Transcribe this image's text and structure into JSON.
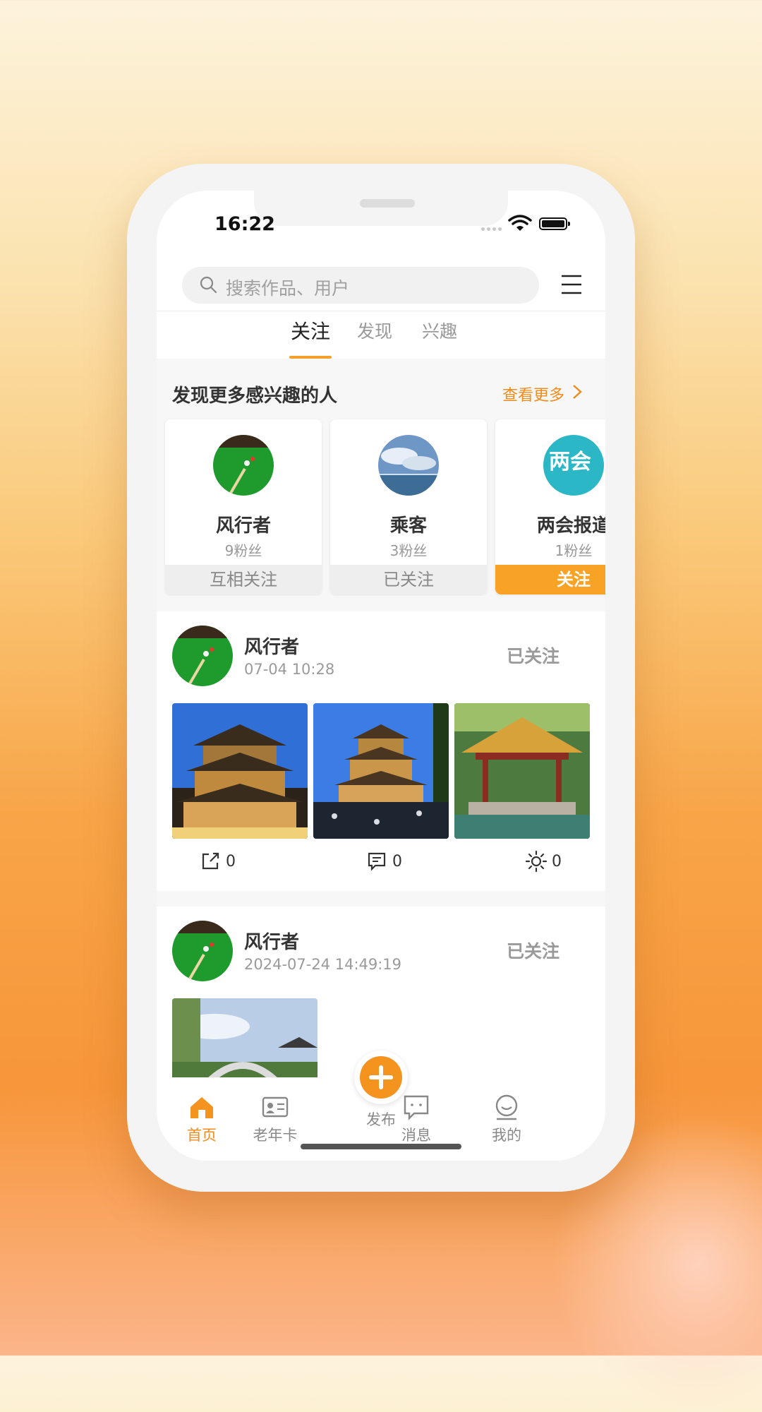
{
  "status_bar": {
    "time": "16:22"
  },
  "search": {
    "placeholder": "搜索作品、用户"
  },
  "tabs": [
    {
      "label": "关注",
      "active": true
    },
    {
      "label": "发现",
      "active": false
    },
    {
      "label": "兴趣",
      "active": false
    }
  ],
  "recommend": {
    "title": "发现更多感兴趣的人",
    "more_label": "查看更多",
    "users": [
      {
        "name": "风行者",
        "fans": "9粉丝",
        "button": "互相关注"
      },
      {
        "name": "乘客",
        "fans": "3粉丝",
        "button": "已关注"
      },
      {
        "name": "两会报道",
        "fans": "1粉丝",
        "button": "关注"
      }
    ]
  },
  "posts": [
    {
      "author": "风行者",
      "time": "07-04 10:28",
      "follow_label": "已关注",
      "stats": {
        "share": "0",
        "comment": "0",
        "like": "0"
      }
    },
    {
      "author": "风行者",
      "time": "2024-07-24 14:49:19",
      "follow_label": "已关注"
    }
  ],
  "tabbar": {
    "home": "首页",
    "card": "老年卡",
    "publish": "发布",
    "messages": "消息",
    "mine": "我的"
  },
  "colors": {
    "accent": "#f5931f",
    "follow_button": "#f8a325"
  }
}
